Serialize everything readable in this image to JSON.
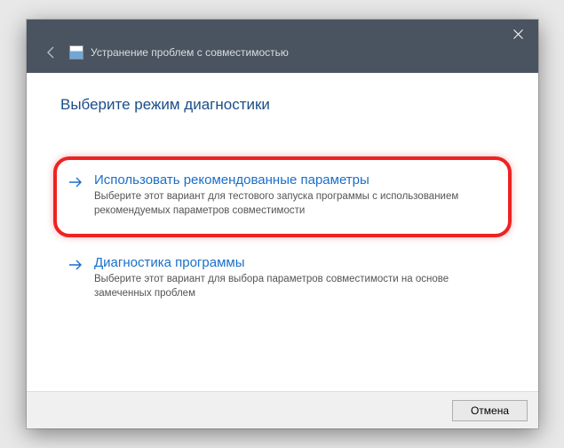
{
  "titlebar": {
    "title": "Устранение проблем с совместимостью"
  },
  "heading": "Выберите режим диагностики",
  "options": [
    {
      "title": "Использовать рекомендованные параметры",
      "desc": "Выберите этот вариант для тестового запуска программы с использованием рекомендуемых параметров совместимости"
    },
    {
      "title": "Диагностика программы",
      "desc": "Выберите этот вариант для выбора параметров совместимости на основе замеченных проблем"
    }
  ],
  "footer": {
    "cancel": "Отмена"
  }
}
